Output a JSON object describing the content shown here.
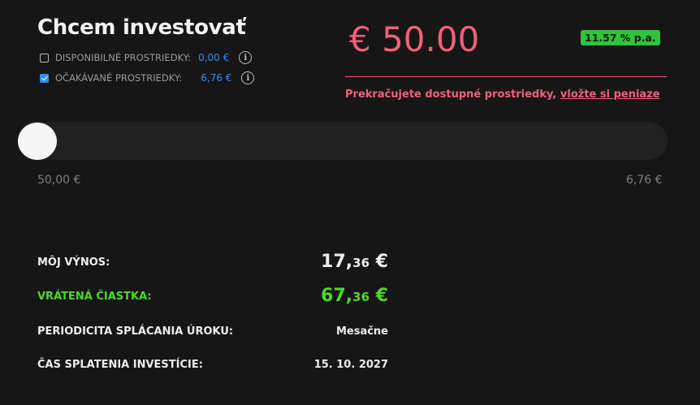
{
  "header": {
    "title": "Chcem investovať"
  },
  "funds": {
    "available": {
      "label": "DISPONIBILNÉ PROSTRIEDKY:",
      "value": "0,00 €",
      "checked": false
    },
    "expected": {
      "label": "OČAKÁVANÉ PROSTRIEDKY:",
      "value": "6,76 €",
      "checked": true
    }
  },
  "investment": {
    "amount": "€ 50.00",
    "rate": "11.57 % p.a.",
    "warning_text": "Prekračujete dostupné prostriedky, ",
    "warning_link": "vložte si peniaze"
  },
  "slider": {
    "min_label": "50,00 €",
    "max_label": "6,76 €",
    "position": 0
  },
  "summary": {
    "yield": {
      "label": "MÔJ VÝNOS:",
      "int": "17,",
      "dec": "36",
      "currency": " €"
    },
    "returned": {
      "label": "VRÁTENÁ ČIASTKA:",
      "int": "67,",
      "dec": "36",
      "currency": " €"
    },
    "periodicity": {
      "label": "PERIODICITA SPLÁCANIA ÚROKU:",
      "value": "Mesačne"
    },
    "maturity": {
      "label": "ČAS SPLATENIA INVESTÍCIE:",
      "value": "15. 10. 2027"
    }
  },
  "colors": {
    "accent_red": "#f0607a",
    "accent_green": "#4fd82a",
    "badge_green": "#2ec43b",
    "link_blue": "#2f8cff",
    "background": "#161616"
  }
}
